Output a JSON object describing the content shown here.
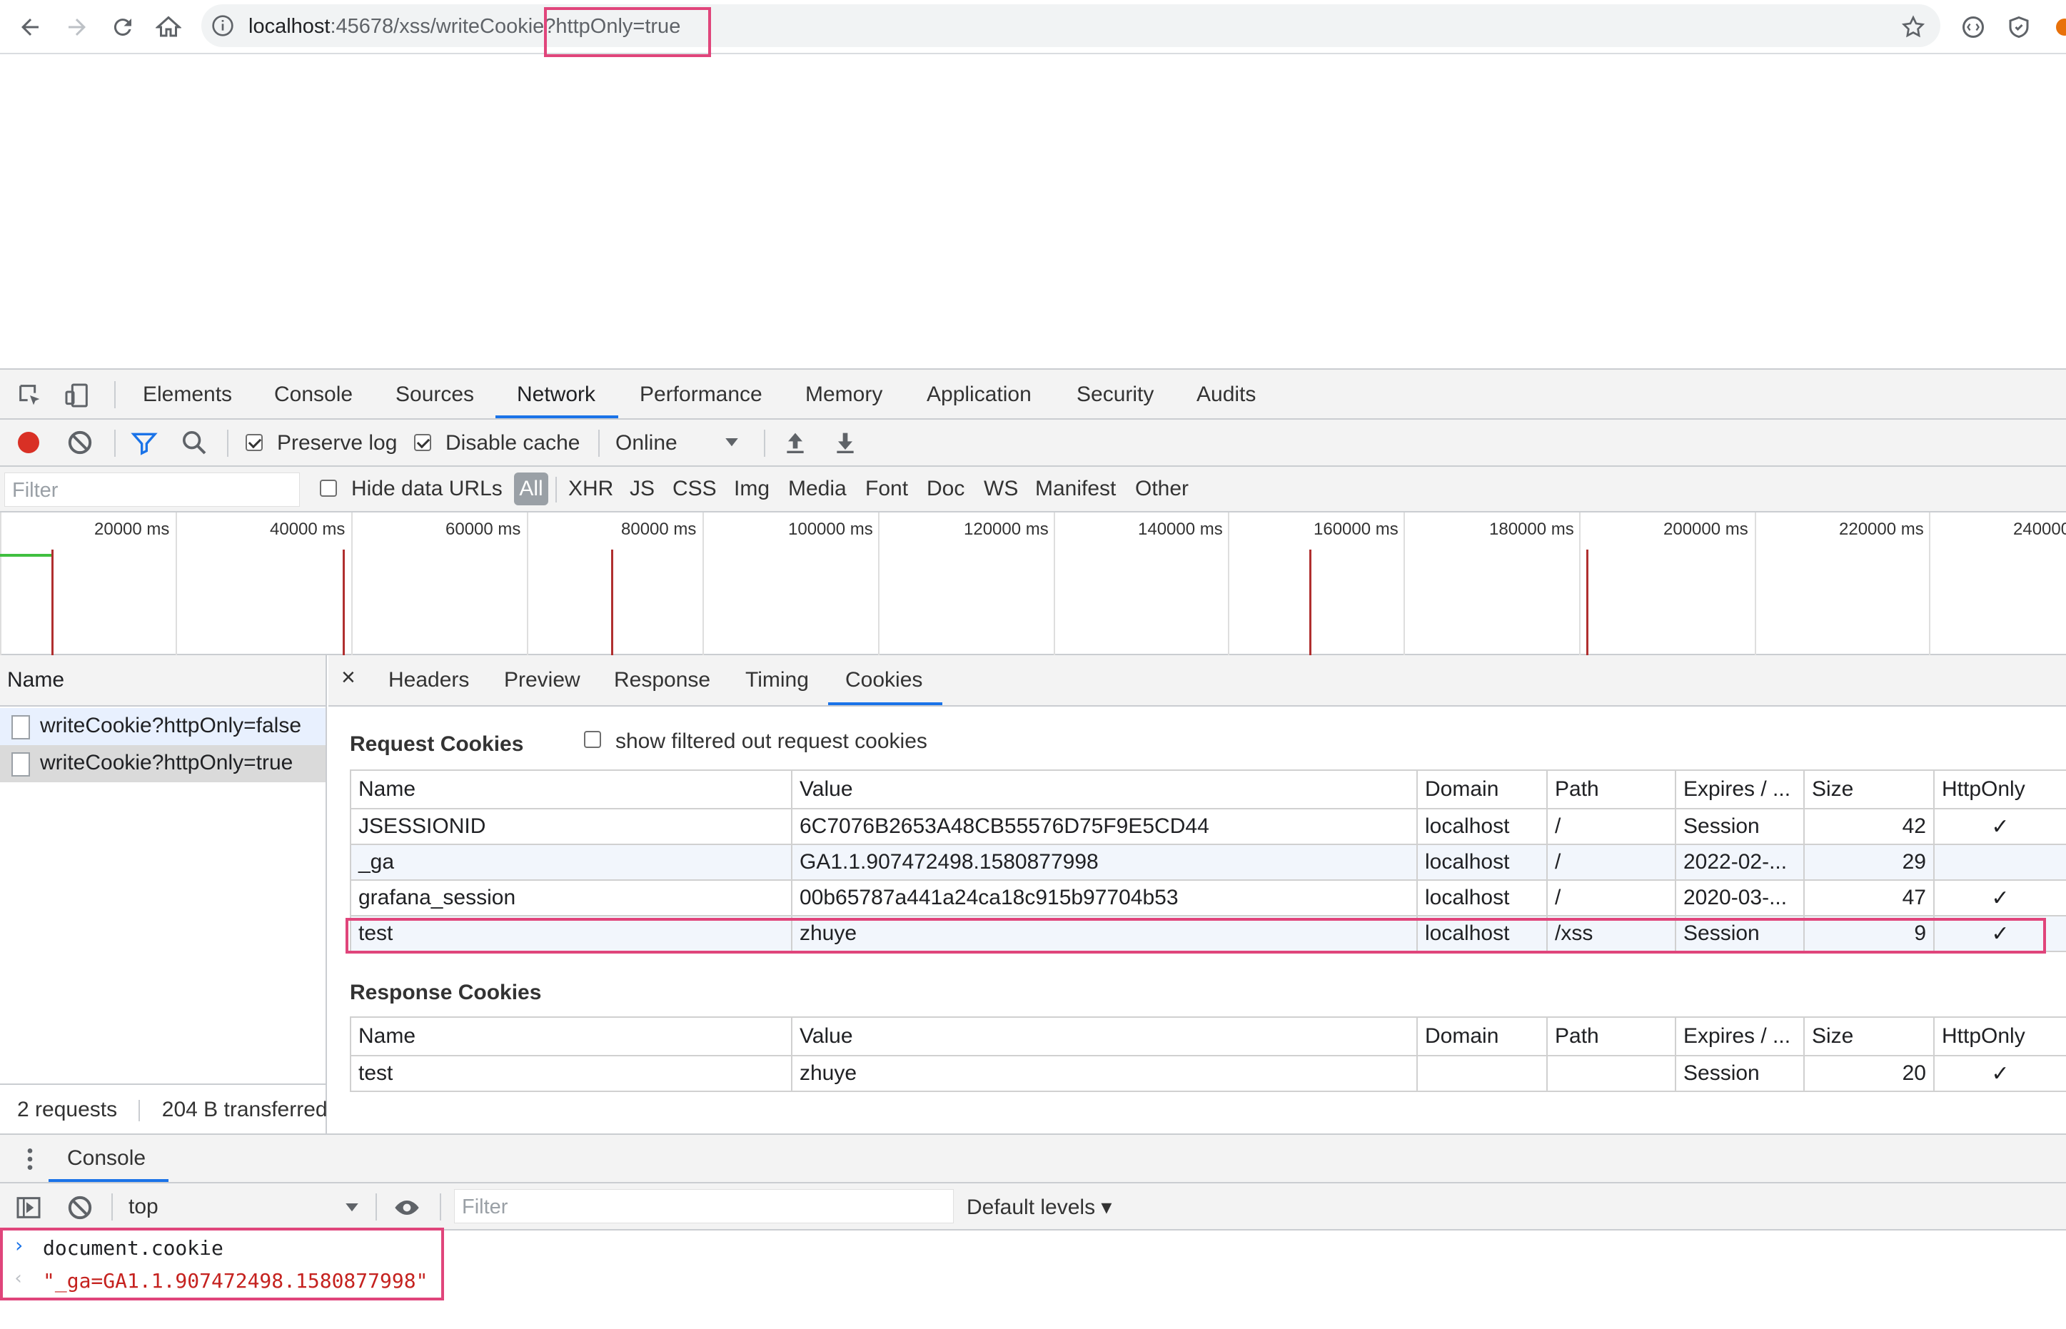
{
  "browser": {
    "url_host": "localhost",
    "url_rest": ":45678/xss/writeCookie?httpOnly=true"
  },
  "devtools": {
    "tabs": [
      "Elements",
      "Console",
      "Sources",
      "Network",
      "Performance",
      "Memory",
      "Application",
      "Security",
      "Audits"
    ],
    "active_tab": "Network"
  },
  "network_toolbar": {
    "preserve_log": "Preserve log",
    "disable_cache": "Disable cache",
    "throttling": "Online"
  },
  "filter_bar": {
    "placeholder": "Filter",
    "hide_data_urls": "Hide data URLs",
    "types": [
      "All",
      "XHR",
      "JS",
      "CSS",
      "Img",
      "Media",
      "Font",
      "Doc",
      "WS",
      "Manifest",
      "Other"
    ]
  },
  "timeline": {
    "labels": [
      "20000 ms",
      "40000 ms",
      "60000 ms",
      "80000 ms",
      "100000 ms",
      "120000 ms",
      "140000 ms",
      "160000 ms",
      "180000 ms",
      "200000 ms",
      "220000 ms",
      "240000"
    ]
  },
  "requests": {
    "header": "Name",
    "items": [
      "writeCookie?httpOnly=false",
      "writeCookie?httpOnly=true"
    ],
    "selected_index": 1,
    "status_count": "2 requests",
    "status_transferred": "204 B transferred"
  },
  "detail": {
    "tabs": [
      "Headers",
      "Preview",
      "Response",
      "Timing",
      "Cookies"
    ],
    "active_tab": "Cookies",
    "request_title": "Request Cookies",
    "show_filtered": "show filtered out request cookies",
    "response_title": "Response Cookies",
    "columns": [
      "Name",
      "Value",
      "Domain",
      "Path",
      "Expires / ...",
      "Size",
      "HttpOnly"
    ],
    "request_cookies": [
      {
        "name": "JSESSIONID",
        "value": "6C7076B2653A48CB55576D75F9E5CD44",
        "domain": "localhost",
        "path": "/",
        "expires": "Session",
        "size": "42",
        "httponly": "✓"
      },
      {
        "name": "_ga",
        "value": "GA1.1.907472498.1580877998",
        "domain": "localhost",
        "path": "/",
        "expires": "2022-02-...",
        "size": "29",
        "httponly": ""
      },
      {
        "name": "grafana_session",
        "value": "00b65787a441a24ca18c915b97704b53",
        "domain": "localhost",
        "path": "/",
        "expires": "2020-03-...",
        "size": "47",
        "httponly": "✓"
      },
      {
        "name": "test",
        "value": "zhuye",
        "domain": "localhost",
        "path": "/xss",
        "expires": "Session",
        "size": "9",
        "httponly": "✓"
      }
    ],
    "response_cookies": [
      {
        "name": "test",
        "value": "zhuye",
        "domain": "",
        "path": "",
        "expires": "Session",
        "size": "20",
        "httponly": "✓"
      }
    ]
  },
  "console_drawer": {
    "tab": "Console",
    "context": "top",
    "filter_placeholder": "Filter",
    "levels": "Default levels ▾",
    "input": "document.cookie",
    "output": "\"_ga=GA1.1.907472498.1580877998\""
  },
  "colors": {
    "highlight": "#e0457b",
    "accent": "#1a73e8",
    "record": "#d93025",
    "console_output": "#c5221f"
  }
}
